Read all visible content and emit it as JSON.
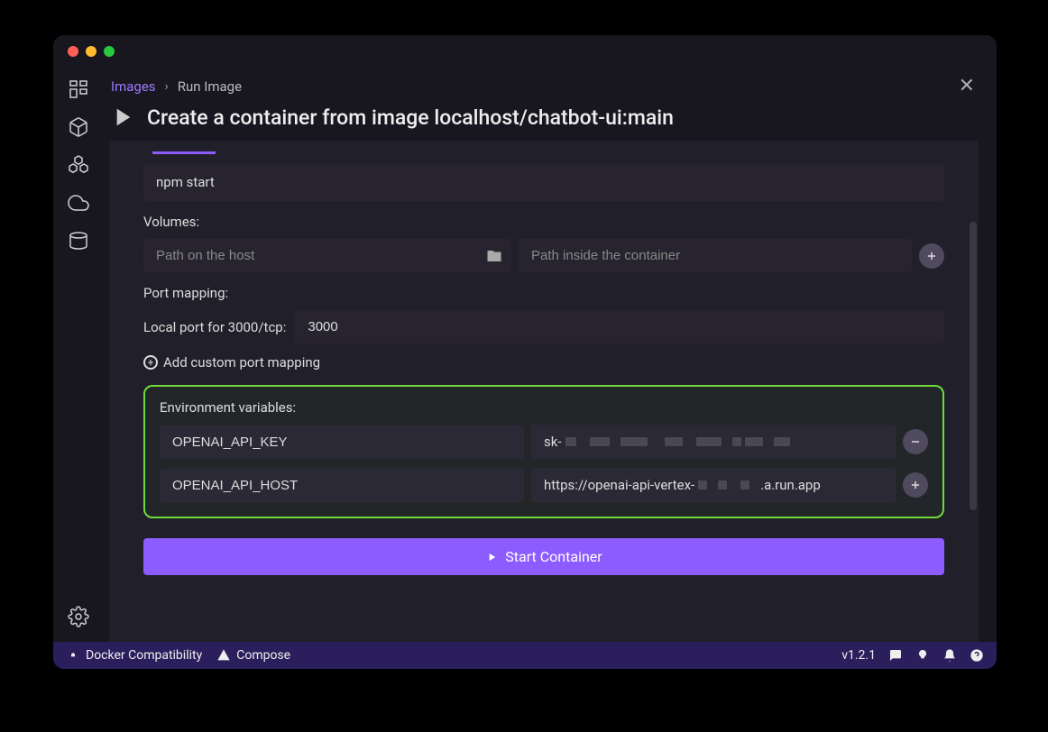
{
  "breadcrumb": {
    "root": "Images",
    "current": "Run Image"
  },
  "title": "Create a container from image localhost/chatbot-ui:main",
  "command": "npm start",
  "volumes": {
    "label": "Volumes:",
    "host_placeholder": "Path on the host",
    "container_placeholder": "Path inside the container"
  },
  "port_mapping": {
    "section_label": "Port mapping:",
    "local_label": "Local port for 3000/tcp:",
    "value": "3000",
    "add_label": "Add custom port mapping"
  },
  "env": {
    "label": "Environment variables:",
    "rows": [
      {
        "name": "OPENAI_API_KEY",
        "value_prefix": "sk-",
        "redacted": true
      },
      {
        "name": "OPENAI_API_HOST",
        "value_prefix": "https://openai-api-vertex-",
        "value_suffix": ".a.run.app",
        "redacted": true
      }
    ]
  },
  "start_button": "Start Container",
  "status": {
    "docker": "Docker Compatibility",
    "compose": "Compose",
    "version": "v1.2.1"
  }
}
